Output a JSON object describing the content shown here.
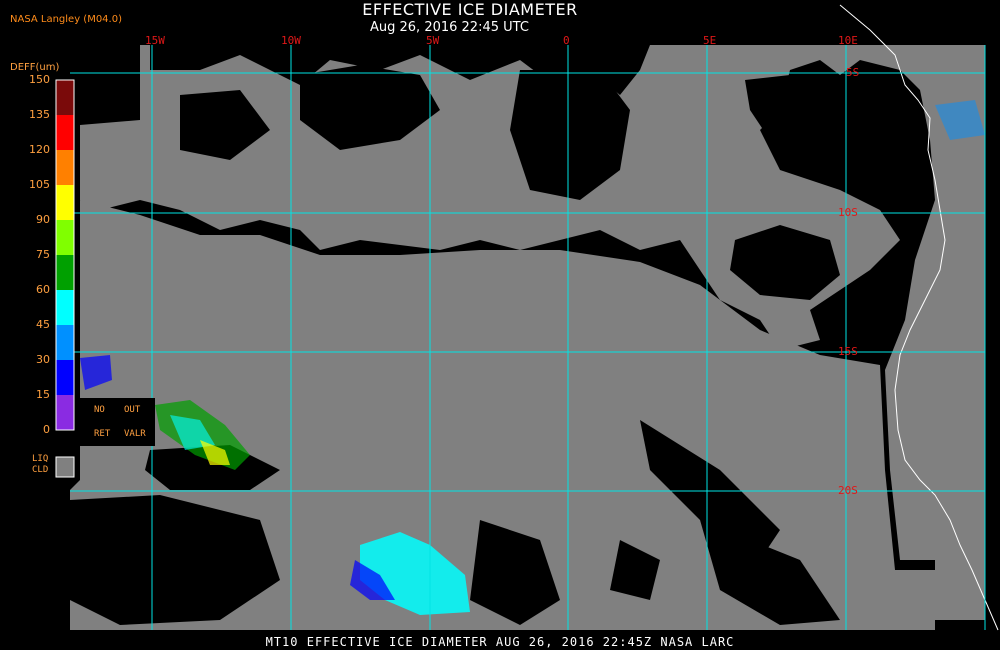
{
  "title": "EFFECTIVE ICE DIAMETER",
  "subtitle": "Aug 26, 2016 22:45 UTC",
  "source": "NASA Langley (M04.0)",
  "footer": "MT10  EFFECTIVE ICE DIAMETER  AUG 26, 2016 22:45Z  NASA LARC",
  "longitudes": [
    "15W",
    "10W",
    "5W",
    "0",
    "5E",
    "10E"
  ],
  "latitudes": [
    "5S",
    "10S",
    "15S",
    "20S"
  ],
  "colorbar": {
    "title": "DEFF(um)",
    "ticks": [
      "150",
      "135",
      "120",
      "105",
      "90",
      "75",
      "60",
      "45",
      "30",
      "15",
      "0"
    ],
    "colors": [
      "#7a0a0a",
      "#ff0000",
      "#ff8000",
      "#ffff00",
      "#80ff00",
      "#00a000",
      "#00ffff",
      "#0090ff",
      "#0000ff",
      "#8a2be2"
    ]
  },
  "legend": {
    "no_ret_line1": "NO",
    "no_ret_line2": "RET",
    "out_valr_line1": "OUT",
    "out_valr_line2": "VALR",
    "liq_line1": "LIQ",
    "liq_line2": "CLD",
    "liq_color": "#808080"
  },
  "colors": {
    "clear": "#000000",
    "liquid_cloud": "#808080",
    "grid": "#00e5e5",
    "coast": "#ffffff"
  }
}
